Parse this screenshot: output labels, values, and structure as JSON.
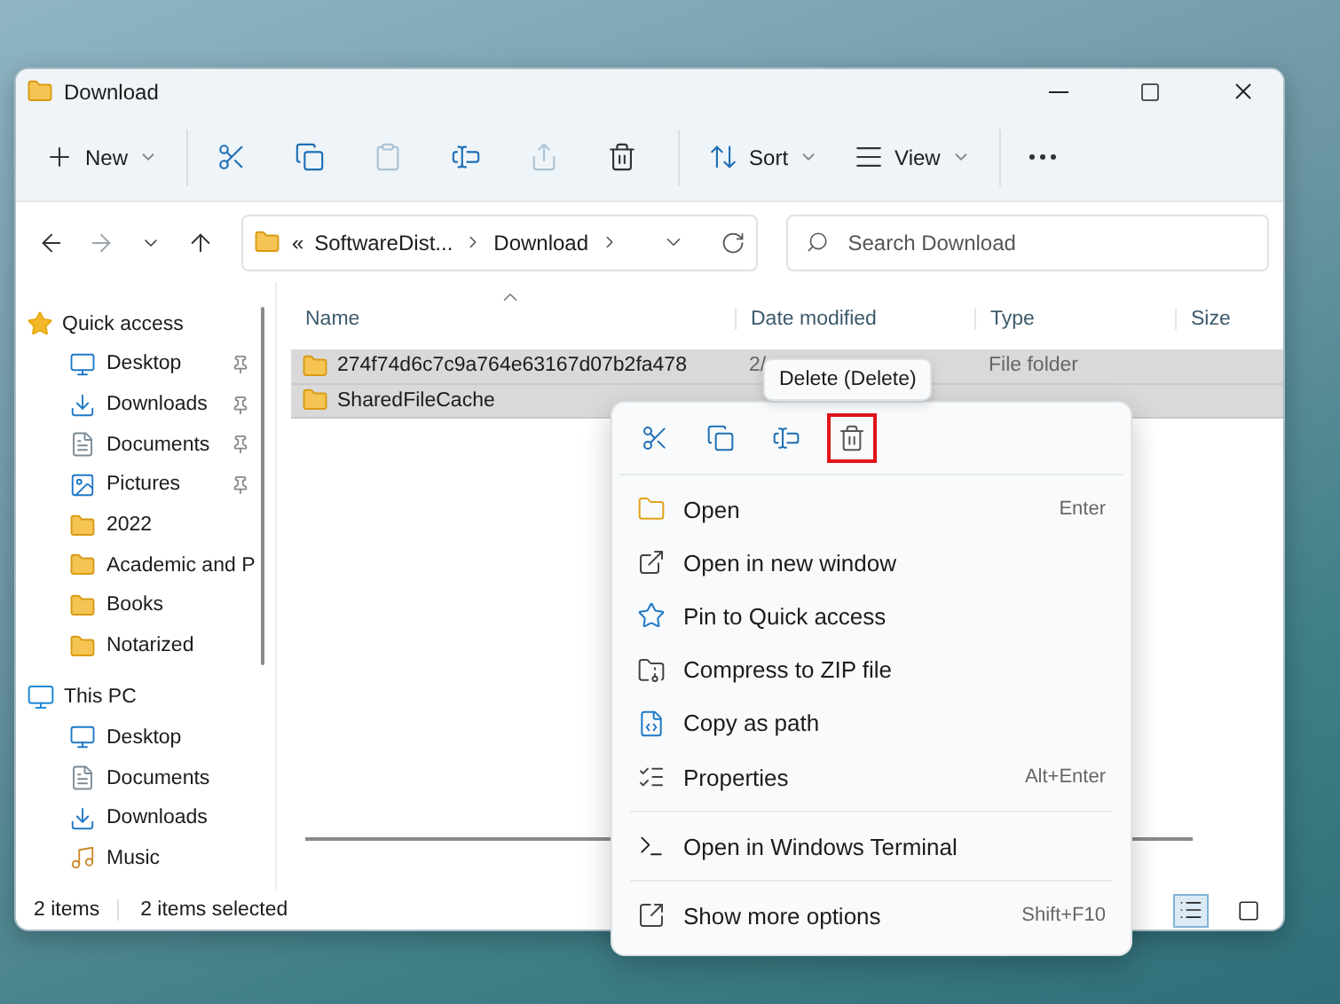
{
  "window": {
    "title": "Download"
  },
  "toolbar": [
    {
      "label": "New",
      "dropdown": true,
      "disabled": false
    },
    {
      "disabled": false
    },
    {
      "disabled": false
    },
    {
      "disabled": true
    },
    {
      "disabled": false
    },
    {
      "disabled": true
    },
    {
      "disabled": false
    },
    {
      "label": "Sort",
      "dropdown": true,
      "disabled": false
    },
    {
      "label": "View",
      "dropdown": true,
      "disabled": false
    }
  ],
  "nav": {
    "back_disabled": false,
    "forward_disabled": true
  },
  "address": {
    "segments": [
      "«",
      "SoftwareDist...",
      "Download"
    ]
  },
  "search": {
    "placeholder": "Search Download"
  },
  "sidebar": {
    "groups": [
      {
        "label": "Quick access",
        "children": [
          {
            "label": "Desktop",
            "pinned": true
          },
          {
            "label": "Downloads",
            "pinned": true
          },
          {
            "label": "Documents",
            "pinned": true
          },
          {
            "label": "Pictures",
            "pinned": true
          },
          {
            "label": "2022",
            "pinned": false
          },
          {
            "label": "Academic and P",
            "pinned": false
          },
          {
            "label": "Books",
            "pinned": false
          },
          {
            "label": "Notarized",
            "pinned": false
          }
        ]
      },
      {
        "label": "This PC",
        "children": [
          {
            "label": "Desktop",
            "pinned": false
          },
          {
            "label": "Documents",
            "pinned": false
          },
          {
            "label": "Downloads",
            "pinned": false
          },
          {
            "label": "Music",
            "pinned": false
          }
        ]
      }
    ]
  },
  "table": {
    "columns": [
      "Name",
      "Date modified",
      "Type",
      "Size"
    ],
    "rows": [
      {
        "name": "274f74d6c7c9a764e63167d07b2fa478",
        "date": "2/",
        "type": "File folder",
        "selected": true
      },
      {
        "name": "SharedFileCache",
        "selected": true
      }
    ]
  },
  "status_bar": {
    "count": "2 items",
    "selection": "2 items selected",
    "views": [
      {
        "selected": true
      },
      {
        "selected": false
      }
    ]
  },
  "context_menu": {
    "actions": [
      {
        "highlighted": false
      },
      {
        "highlighted": false
      },
      {
        "highlighted": false
      },
      {
        "highlighted": true
      }
    ],
    "tooltip": "Delete (Delete)",
    "groups": [
      [
        {
          "label": "Open",
          "shortcut": "Enter"
        },
        {
          "label": "Open in new window"
        },
        {
          "label": "Pin to Quick access"
        },
        {
          "label": "Compress to ZIP file"
        },
        {
          "label": "Copy as path"
        },
        {
          "label": "Properties",
          "shortcut": "Alt+Enter"
        }
      ],
      [
        {
          "label": "Open in Windows Terminal"
        }
      ],
      [
        {
          "label": "Show more options",
          "shortcut": "Shift+F10"
        }
      ]
    ]
  }
}
